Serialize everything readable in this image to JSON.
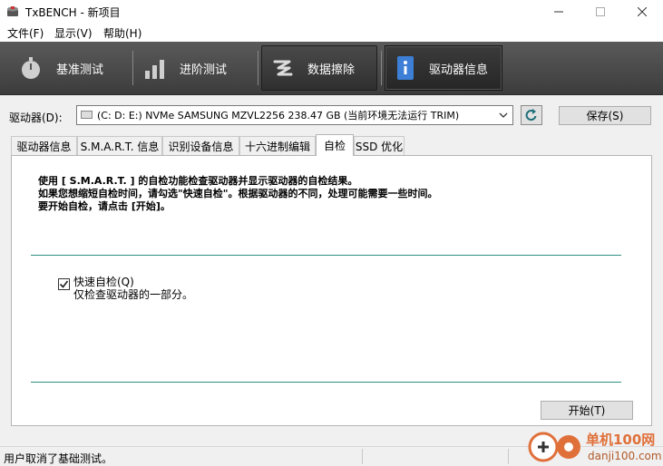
{
  "window": {
    "title": "TxBENCH - 新项目"
  },
  "menu": [
    "文件(F)",
    "显示(V)",
    "帮助(H)"
  ],
  "toolbar": {
    "buttons": [
      {
        "label": "基准测试",
        "icon": "stopwatch-icon"
      },
      {
        "label": "进阶测试",
        "icon": "bar-chart-icon"
      },
      {
        "label": "数据擦除",
        "icon": "erase-icon"
      },
      {
        "label": "驱动器信息",
        "icon": "drive-info-icon",
        "active": true
      }
    ]
  },
  "drive": {
    "label": "驱动器(D):",
    "selected": "(C: D: E:) NVMe SAMSUNG MZVL2256  238.47 GB (当前环境无法运行 TRIM)",
    "save_label": "保存(S)"
  },
  "tabs": [
    {
      "label": "驱动器信息"
    },
    {
      "label": "S.M.A.R.T. 信息"
    },
    {
      "label": "识别设备信息"
    },
    {
      "label": "十六进制编辑"
    },
    {
      "label": "自检",
      "active": true
    },
    {
      "label": "SSD 优化"
    }
  ],
  "selftest": {
    "desc_lines": [
      "使用 [ S.M.A.R.T. ] 的自检功能检查驱动器并显示驱动器的自检结果。",
      "如果您想缩短自检时间，请勾选\"快速自检\"。根据驱动器的不同，处理可能需要一些时间。",
      "要开始自检，请点击 [开始]。"
    ],
    "quick_label": "快速自检(Q)",
    "quick_checked": true,
    "quick_sub": "仅检查驱动器的一部分。",
    "start_label": "开始(T)"
  },
  "status": {
    "text": "用户取消了基础测试。"
  },
  "watermark": {
    "site_cn": "单机100网",
    "site_url": "danji100.com"
  },
  "colors": {
    "toolbar": "#474747",
    "separator_line": "#2f8f86",
    "watermark": "#e0703a"
  }
}
